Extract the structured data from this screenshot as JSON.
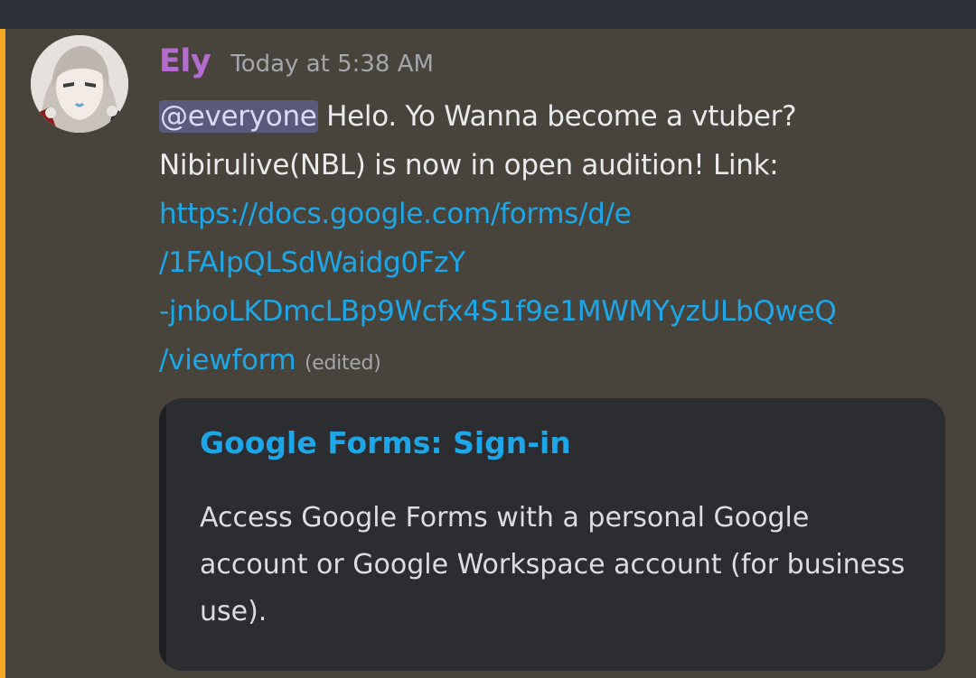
{
  "message": {
    "author": "Ely",
    "timestamp": "Today at 5:38 AM",
    "mention": "@everyone",
    "text_line1": " Helo. Yo Wanna become a vtuber?",
    "text_line2": "Nibirulive(NBL) is now in open audition!  Link:",
    "link_lines": [
      "https://docs.google.com/forms/d/e",
      "/1FAIpQLSdWaidg0FzY",
      "-jnboLKDmcLBp9Wcfx4S1f9e1MWMYyzULbQweQ",
      "/viewform"
    ],
    "edited_label": "(edited)"
  },
  "embed": {
    "title": "Google Forms: Sign-in",
    "description": "Access Google Forms with a personal Google account or Google Workspace account (for business use)."
  },
  "colors": {
    "background": "#48443c",
    "topbar": "#2c3038",
    "mention_bar": "#f5a623",
    "username": "#b56ccf",
    "link": "#1da7e8",
    "embed_bg": "#2b2d31"
  }
}
